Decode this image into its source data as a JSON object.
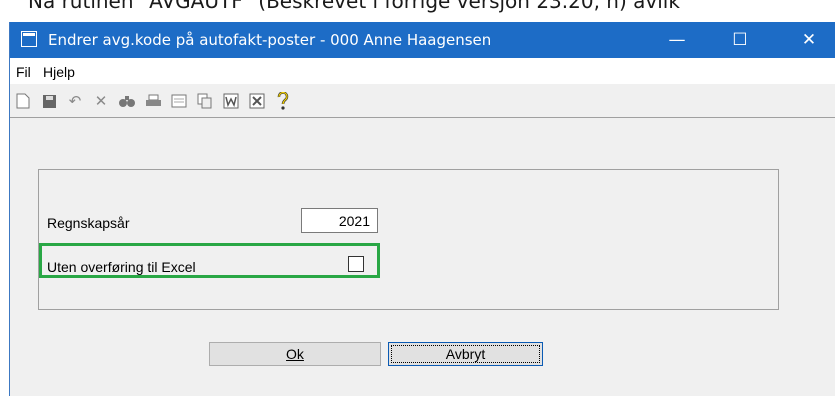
{
  "background": {
    "text": "Nå rutinen \"AVGAUTF\" (Beskrevet i forrige versjon 23.20, n) avlik"
  },
  "window": {
    "title": "Endrer avg.kode på autofakt-poster - 000 Anne Haagensen",
    "controls": {
      "minimize": "—",
      "maximize": "☐",
      "close": "✕"
    }
  },
  "menu": {
    "items": [
      "Fil",
      "Hjelp"
    ]
  },
  "toolbar": {
    "icons": [
      "new-icon",
      "save-icon",
      "undo-icon",
      "delete-icon",
      "find-icon",
      "print-icon",
      "calculator-icon",
      "copy-icon",
      "word-icon",
      "excel-icon",
      "help-icon"
    ]
  },
  "form": {
    "year_label": "Regnskapsår",
    "year_value": "2021",
    "excel_label": "Uten overføring til Excel",
    "excel_checked": false
  },
  "buttons": {
    "ok": "Ok",
    "cancel": "Avbryt"
  },
  "colors": {
    "titlebar": "#1d6cc6",
    "highlight": "#29a745"
  }
}
